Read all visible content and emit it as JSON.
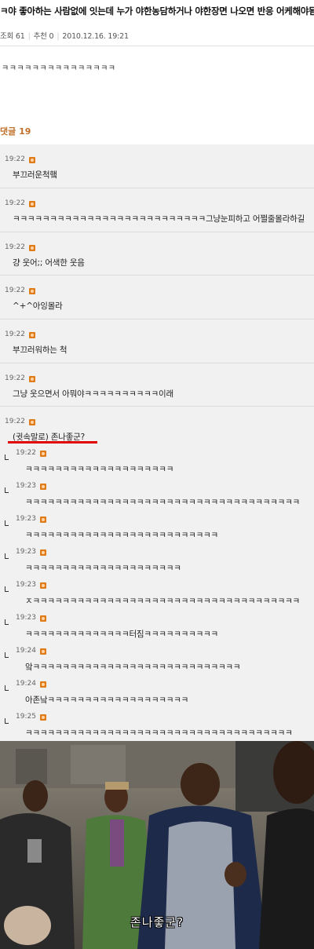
{
  "post": {
    "title": "ㅋ야 좋아하는 사람없에 잇는데 누가 야한농담하거나 야한장면 나오면 반응 어케해야됨..ㅅㅂ",
    "views_label": "조회 61",
    "recommend_label": "추천 0",
    "date": "2010.12.16. 19:21",
    "body": "ㅋㅋㅋㅋㅋㅋㅋㅋㅋㅋㅋㅋㅋㅋㅋ"
  },
  "comments": {
    "header": "댓글 19",
    "items": [
      {
        "time": "19:22",
        "text": "부끄러운척햌"
      },
      {
        "time": "19:22",
        "text": "ㅋㅋㅋㅋㅋㅋㅋㅋㅋㅋㅋㅋㅋㅋㅋㅋㅋㅋㅋㅋㅋㅋㅋㅋㅋㅋ그냥눈피하고 어쩔줄몰라하길"
      },
      {
        "time": "19:22",
        "text": "걍 웃어;; 어색한 웃음"
      },
      {
        "time": "19:22",
        "text": "^+^아잉몰라"
      },
      {
        "time": "19:22",
        "text": "부끄러워하는 척"
      },
      {
        "time": "19:22",
        "text": "그냥 웃으면서 아뭐야ㅋㅋㅋㅋㅋㅋㅋㅋㅋㅋ이래"
      },
      {
        "time": "19:22",
        "text": "(귓속말로) 존나좋군?"
      }
    ],
    "replies": [
      {
        "time": "19:22",
        "text": "ㅋㅋㅋㅋㅋㅋㅋㅋㅋㅋㅋㅋㅋㅋㅋㅋㅋㅋㅋㅋ"
      },
      {
        "time": "19:23",
        "text": "ㅋㅋㅋㅋㅋㅋㅋㅋㅋㅋㅋㅋㅋㅋㅋㅋㅋㅋㅋㅋㅋㅋㅋㅋㅋㅋㅋㅋㅋㅋㅋㅋㅋㅋㅋㅋㅋ"
      },
      {
        "time": "19:23",
        "text": "ㅋㅋㅋㅋㅋㅋㅋㅋㅋㅋㅋㅋㅋㅋㅋㅋㅋㅋㅋㅋㅋㅋㅋㅋㅋㅋ"
      },
      {
        "time": "19:23",
        "text": "ㅋㅋㅋㅋㅋㅋㅋㅋㅋㅋㅋㅋㅋㅋㅋㅋㅋㅋㅋㅋㅋ"
      },
      {
        "time": "19:23",
        "text": "ㅈㅋㅋㅋㅋㅋㅋㅋㅋㅋㅋㅋㅋㅋㅋㅋㅋㅋㅋㅋㅋㅋㅋㅋㅋㅋㅋㅋㅋㅋㅋㅋㅋㅋㅋㅋㅋ"
      },
      {
        "time": "19:23",
        "text": "ㅋㅋㅋㅋㅋㅋㅋㅋㅋㅋㅋㅋㅋㅋ터짐ㅋㅋㅋㅋㅋㅋㅋㅋㅋㅋ"
      },
      {
        "time": "19:24",
        "text": "앜ㅋㅋㅋㅋㅋㅋㅋㅋㅋㅋㅋㅋㅋㅋㅋㅋㅋㅋㅋㅋㅋㅋㅋㅋㅋㅋㅋㅋ"
      },
      {
        "time": "19:24",
        "text": "아존낰ㅋㅋㅋㅋㅋㅋㅋㅋㅋㅋㅋㅋㅋㅋㅋㅋㅋㅋㅋ"
      },
      {
        "time": "19:25",
        "text": "ㅋㅋㅋㅋㅋㅋㅋㅋㅋㅋㅋㅋㅋㅋㅋㅋㅋㅋㅋㅋㅋㅋㅋㅋㅋㅋㅋㅋㅋㅋㅋㅋㅋㅋㅋㅋ"
      }
    ]
  },
  "image": {
    "subtitle": "존나좋군?"
  },
  "colors": {
    "accent": "#c0702a",
    "badge": "#e07b1a",
    "underline": "#e00000",
    "comment_bg": "#f1f1f1"
  },
  "icons": {
    "author_badge": "author-badge-icon",
    "reply": "reply-arrow-icon"
  }
}
